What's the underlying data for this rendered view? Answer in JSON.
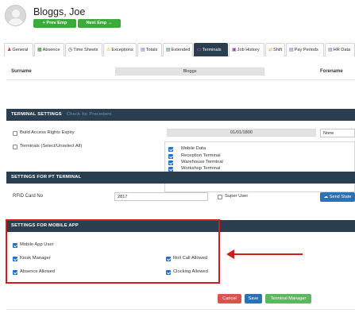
{
  "employee": {
    "name": "Bloggs, Joe"
  },
  "nav": {
    "prev_label": "+ Prev Emp",
    "next_label": "Next Emp →"
  },
  "tabs": [
    {
      "label": "General",
      "icon": "person-icon"
    },
    {
      "label": "Absence",
      "icon": "calendar-icon"
    },
    {
      "label": "Time Sheets",
      "icon": "clock-icon"
    },
    {
      "label": "Exceptions",
      "icon": "warning-icon"
    },
    {
      "label": "Totals",
      "icon": "bar-chart-icon"
    },
    {
      "label": "Extended",
      "icon": "list-icon"
    },
    {
      "label": "Terminals",
      "icon": "terminal-icon",
      "active": true
    },
    {
      "label": "Job History",
      "icon": "briefcase-icon"
    },
    {
      "label": "Shift",
      "icon": "shuffle-icon"
    },
    {
      "label": "Pay Periods",
      "icon": "money-icon"
    },
    {
      "label": "HR Data",
      "icon": "document-icon"
    }
  ],
  "surname": {
    "label": "Surname",
    "value": "Bloggs",
    "forename_label": "Forename"
  },
  "terminal_settings": {
    "title": "TERMINAL SETTINGS",
    "subtitle": "Check for Precedent",
    "build_access_label": "Build Access Rights Expiry",
    "build_access_checked": false,
    "date_value": "01/01/1800",
    "none_select": "None",
    "terminals_label": "Terminals (Select/Unselect All)",
    "terminals_checked": false,
    "terminals": [
      {
        "label": "Mobile Data",
        "checked": true
      },
      {
        "label": "Reception Terminal",
        "checked": true
      },
      {
        "label": "Warehouse Terminal",
        "checked": true
      },
      {
        "label": "Workshop Terminal",
        "checked": true
      }
    ]
  },
  "pt_terminal": {
    "title": "SETTINGS FOR PT TERMINAL",
    "rfid_label": "RFID Card No",
    "rfid_value": "2817",
    "super_user_label": "Super User",
    "super_user_checked": false,
    "send_button": "Send State"
  },
  "mobile_app": {
    "title": "SETTINGS FOR MOBILE APP",
    "options": [
      {
        "label": "Mobile App User",
        "checked": true
      },
      {
        "label": "Kiosk Manager",
        "checked": true
      },
      {
        "label": "Roll Call Allowed",
        "checked": true
      },
      {
        "label": "Absence Allowed",
        "checked": true
      },
      {
        "label": "Clocking Allowed",
        "checked": true
      }
    ]
  },
  "actions": {
    "cancel": "Cancel",
    "save": "Save",
    "terminal_manager": "Terminal Manager"
  },
  "colors": {
    "header_bar": "#2b3e50",
    "green": "#3cab3c",
    "highlight": "#d21c1c",
    "checkbox": "#1f6fd0"
  }
}
